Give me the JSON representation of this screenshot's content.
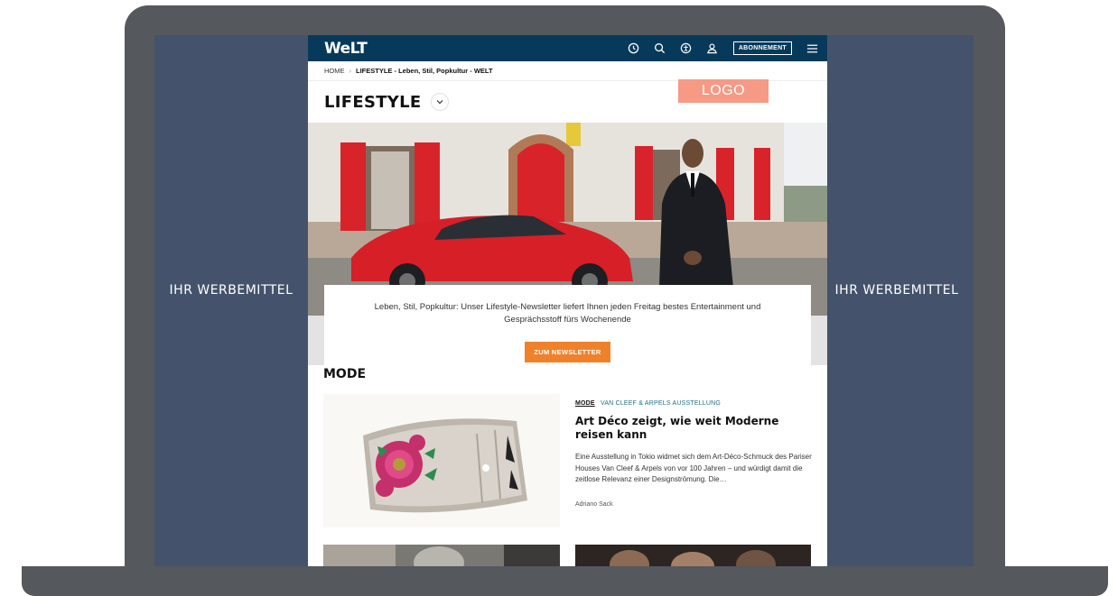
{
  "ads": {
    "left_label": "IHR WERBEMITTEL",
    "right_label": "IHR WERBEMITTEL"
  },
  "header": {
    "brand": "WeLT",
    "subscribe_label": "ABONNEMENT",
    "icons": [
      "clock-icon",
      "search-icon",
      "accessibility-icon",
      "user-icon",
      "menu-icon"
    ],
    "bg_color": "#073a5a"
  },
  "breadcrumb": {
    "home": "HOME",
    "current": "LIFESTYLE - Leben, Stil, Popkultur - WELT"
  },
  "section": {
    "title": "LIFESTYLE"
  },
  "logo_placeholder": {
    "label": "LOGO",
    "color": "#f69985"
  },
  "newsletter": {
    "text": "Leben, Stil, Popkultur: Unser Lifestyle-Newsletter liefert Ihnen jeden Freitag bestes Entertainment und Gesprächsstoff fürs Wochenende",
    "button_label": "ZUM NEWSLETTER",
    "button_color": "#f0812b"
  },
  "mode_section": {
    "title": "MODE",
    "article": {
      "tag": "MODE",
      "kicker": "VAN CLEEF & ARPELS AUSSTELLUNG",
      "headline": "Art Déco zeigt, wie weit Moderne reisen kann",
      "teaser": "Eine Ausstellung in Tokio widmet sich dem Art-Déco-Schmuck des Pariser Houses Van Cleef & Arpels von vor 100 Jahren – und würdigt damit die zeitlose Relevanz einer Designströmung. Die…",
      "author": "Adriano Sack"
    }
  }
}
